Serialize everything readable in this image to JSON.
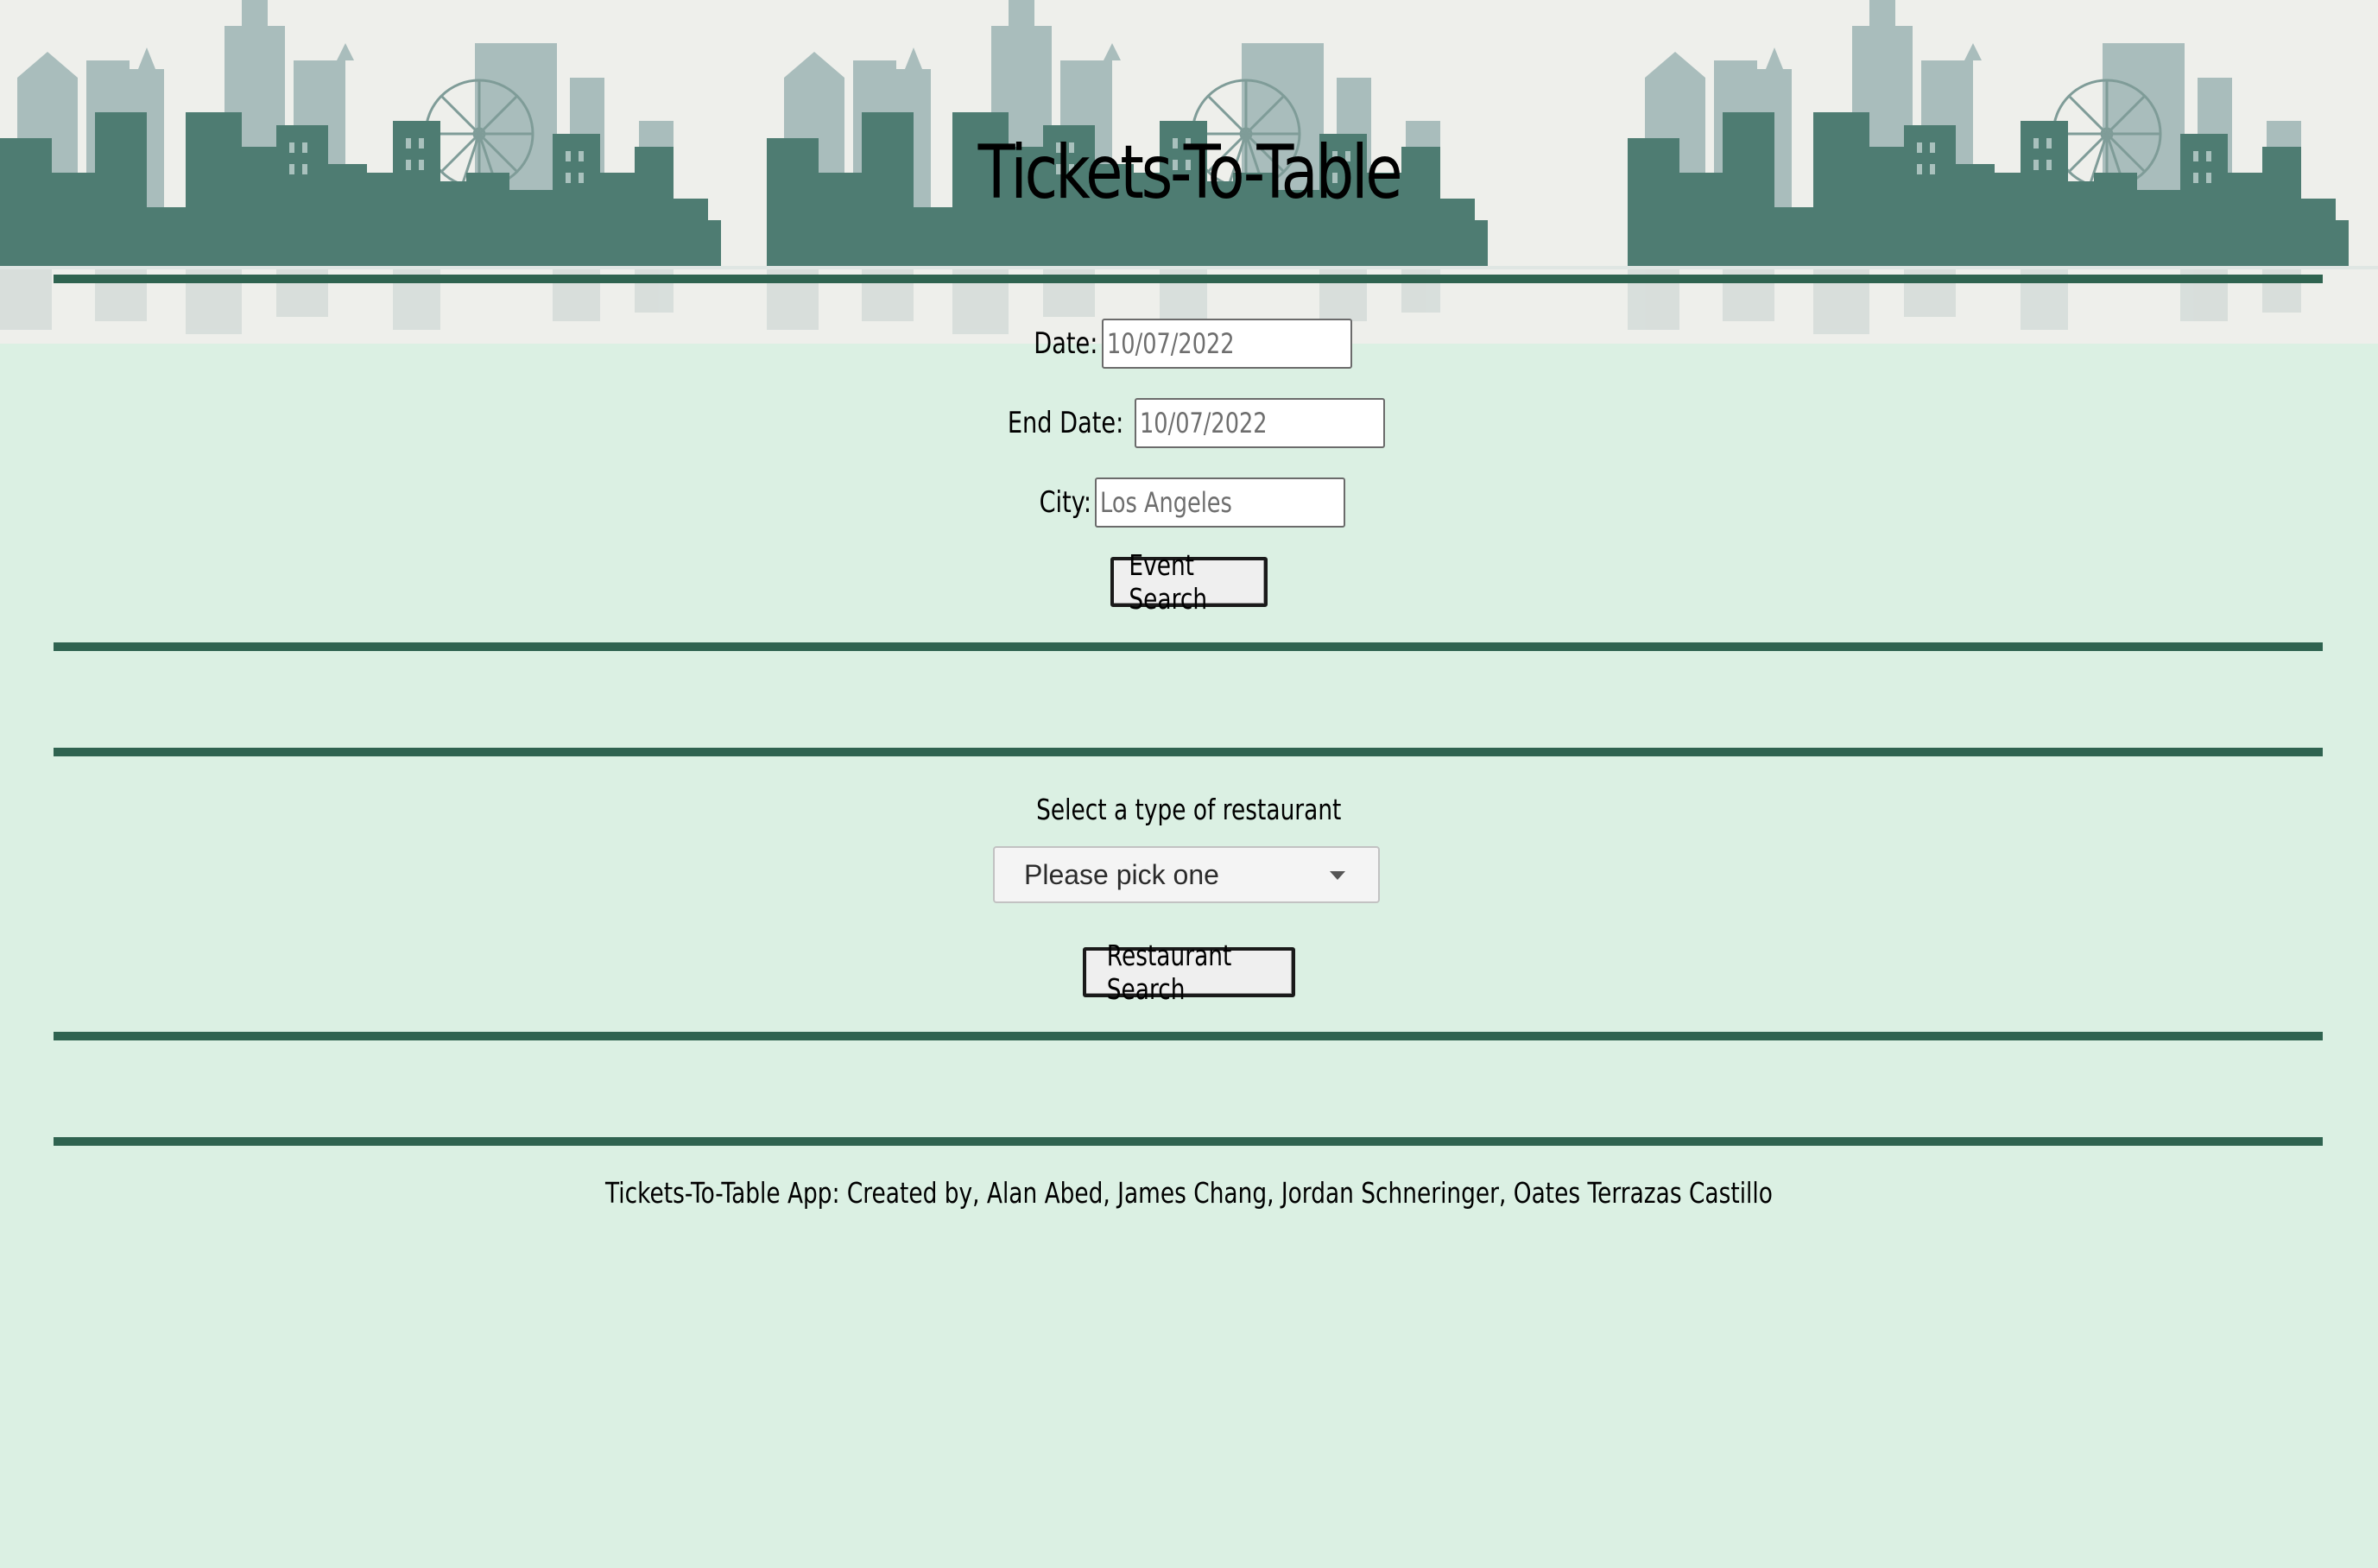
{
  "header": {
    "title": "Tickets-To-Table"
  },
  "event_form": {
    "date_label": "Date:",
    "date_value": "10/07/2022",
    "end_date_label": "End Date:",
    "end_date_value": "10/07/2022",
    "city_label": "City:",
    "city_placeholder": "Los Angeles",
    "search_button": "Event Search"
  },
  "restaurant_form": {
    "prompt": "Select a type of restaurant",
    "selected_option": "Please pick one",
    "search_button": "Restaurant Search"
  },
  "footer": {
    "credits": "Tickets-To-Table App: Created by, Alan Abed, James Chang, Jordan Schneringer, Oates Terrazas Castillo"
  },
  "colors": {
    "page_background": "#dbf0e3",
    "banner_background": "#eeefeb",
    "rule": "#2f6350",
    "skyline_dark": "#4e7c72",
    "skyline_light": "#a9bdbc"
  }
}
